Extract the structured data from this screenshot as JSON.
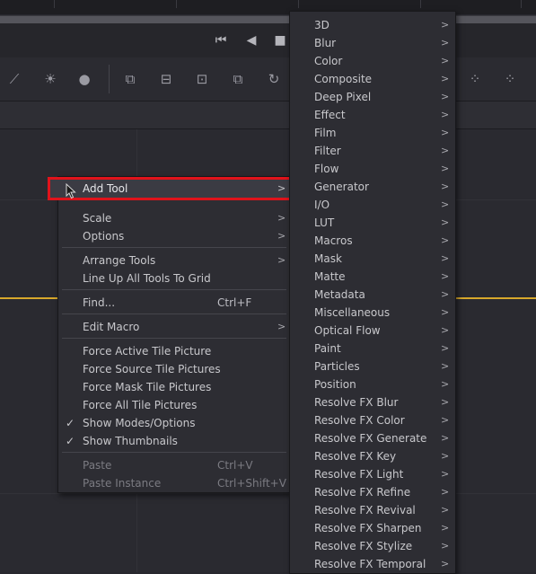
{
  "transport": {
    "icons": [
      "skip-back-icon",
      "play-reverse-icon",
      "stop-icon"
    ],
    "glyphs": [
      "⏮",
      "◀",
      "■"
    ]
  },
  "toolbar": {
    "glyphs": [
      "⟋",
      "☀",
      "●",
      "⧉",
      "⊟",
      "⊡",
      "⧉",
      "↻",
      "⁘",
      "⁘"
    ]
  },
  "context_menu": {
    "add_tool": {
      "label": "Add Tool",
      "arrow": ">"
    },
    "items": [
      {
        "label": "Scale",
        "arrow": ">"
      },
      {
        "label": "Options",
        "arrow": ">"
      },
      {
        "label": "Arrange Tools",
        "arrow": ">"
      },
      {
        "label": "Line Up All Tools To Grid"
      },
      {
        "label": "Find...",
        "shortcut": "Ctrl+F"
      },
      {
        "label": "Edit Macro",
        "arrow": ">"
      },
      {
        "label": "Force Active Tile Picture"
      },
      {
        "label": "Force Source Tile Pictures"
      },
      {
        "label": "Force Mask Tile Pictures"
      },
      {
        "label": "Force All Tile Pictures"
      },
      {
        "label": "Show Modes/Options",
        "check": "✓"
      },
      {
        "label": "Show Thumbnails",
        "check": "✓"
      },
      {
        "label": "Paste",
        "shortcut": "Ctrl+V"
      },
      {
        "label": "Paste Instance",
        "shortcut": "Ctrl+Shift+V"
      }
    ]
  },
  "submenu": {
    "arrow": ">",
    "items": [
      "3D",
      "Blur",
      "Color",
      "Composite",
      "Deep Pixel",
      "Effect",
      "Film",
      "Filter",
      "Flow",
      "Generator",
      "I/O",
      "LUT",
      "Macros",
      "Mask",
      "Matte",
      "Metadata",
      "Miscellaneous",
      "Optical Flow",
      "Paint",
      "Particles",
      "Position",
      "Resolve FX Blur",
      "Resolve FX Color",
      "Resolve FX Generate",
      "Resolve FX Key",
      "Resolve FX Light",
      "Resolve FX Refine",
      "Resolve FX Revival",
      "Resolve FX Sharpen",
      "Resolve FX Stylize",
      "Resolve FX Temporal"
    ]
  },
  "colors": {
    "highlight_border": "#e0131b",
    "timeline_line": "#d8a82b"
  }
}
